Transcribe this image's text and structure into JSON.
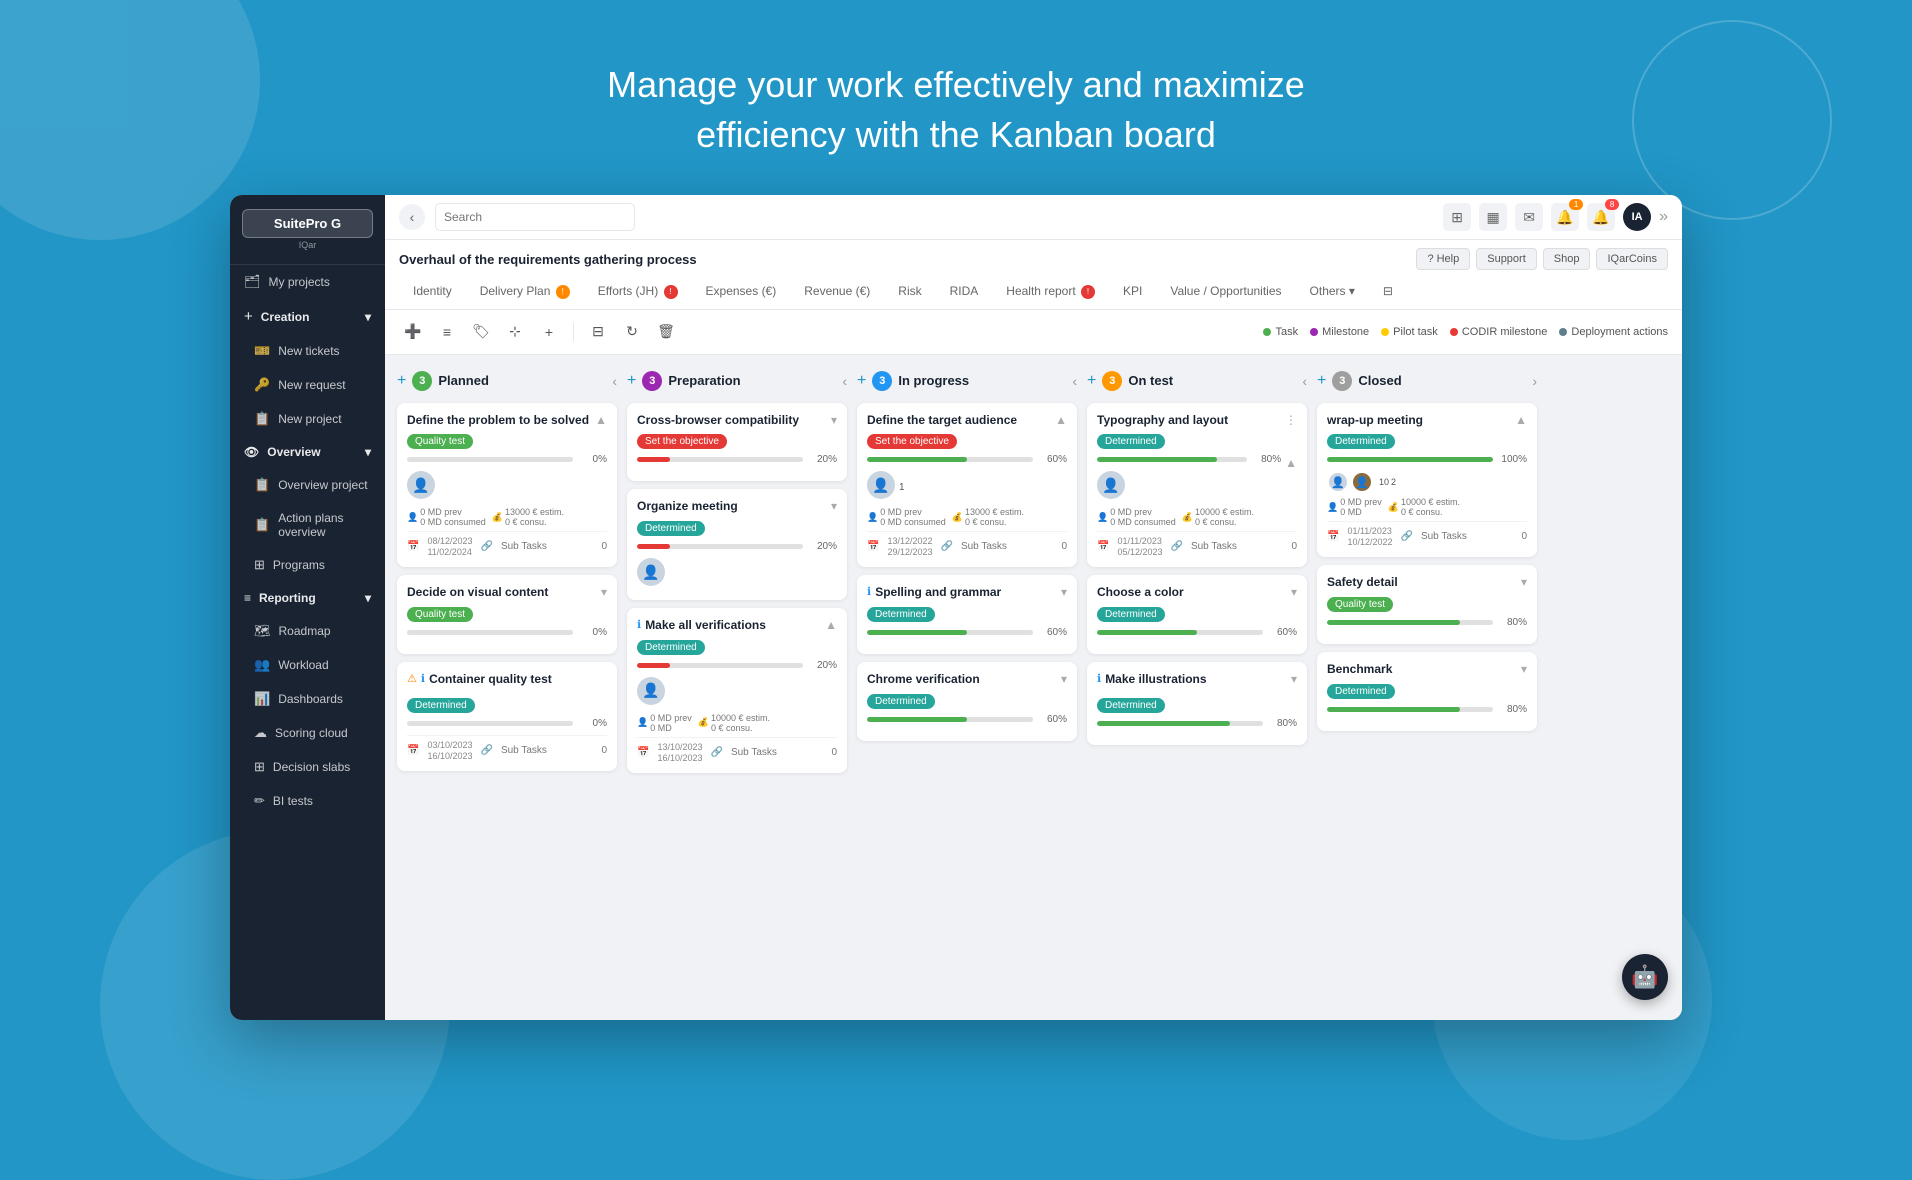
{
  "page": {
    "headline_line1": "Manage your work effectively and maximize",
    "headline_line2": "efficiency with the Kanban board"
  },
  "sidebar": {
    "logo": "SuitePro G",
    "logo_sub": "IQar",
    "items": [
      {
        "label": "My projects",
        "icon": "🗂"
      },
      {
        "label": "Creation",
        "icon": "+",
        "section": true
      },
      {
        "label": "New tickets",
        "icon": "🎫"
      },
      {
        "label": "New request",
        "icon": "🔑"
      },
      {
        "label": "New project",
        "icon": "📋"
      },
      {
        "label": "Overview",
        "icon": "👁",
        "section": true
      },
      {
        "label": "Overview project",
        "icon": "📋"
      },
      {
        "label": "Action plans overview",
        "icon": "📋"
      },
      {
        "label": "Programs",
        "icon": "⊞"
      },
      {
        "label": "Reporting",
        "icon": "≡",
        "section": true
      },
      {
        "label": "Roadmap",
        "icon": "🗺"
      },
      {
        "label": "Workload",
        "icon": "👥"
      },
      {
        "label": "Dashboards",
        "icon": "📊"
      },
      {
        "label": "Scoring cloud",
        "icon": "☁"
      },
      {
        "label": "Decision slabs",
        "icon": "⊞"
      },
      {
        "label": "BI tests",
        "icon": "✏"
      }
    ]
  },
  "topbar": {
    "search_placeholder": "Search",
    "back_label": "‹",
    "collapse_label": "»",
    "avatar_label": "IA",
    "notification_count": "1",
    "bell_count": "8"
  },
  "project": {
    "title": "Overhaul of the requirements gathering process",
    "actions": {
      "help": "? Help",
      "support": "Support",
      "shop": "Shop",
      "coins": "IQarCoins"
    }
  },
  "tabs": [
    {
      "label": "Identity",
      "active": false
    },
    {
      "label": "Delivery Plan",
      "active": false,
      "badge": "orange"
    },
    {
      "label": "Efforts (JH)",
      "active": false,
      "badge": "red"
    },
    {
      "label": "Expenses (€)",
      "active": false
    },
    {
      "label": "Revenue (€)",
      "active": false
    },
    {
      "label": "Risk",
      "active": false
    },
    {
      "label": "RIDA",
      "active": false
    },
    {
      "label": "Health report",
      "active": false,
      "badge": "red"
    },
    {
      "label": "KPI",
      "active": false
    },
    {
      "label": "Value / Opportunities",
      "active": false
    },
    {
      "label": "Others",
      "active": false
    }
  ],
  "legend": {
    "items": [
      {
        "label": "Task",
        "color": "#4caf50"
      },
      {
        "label": "Milestone",
        "color": "#9c27b0"
      },
      {
        "label": "Pilot task",
        "color": "#ffcc00"
      },
      {
        "label": "CODIR milestone",
        "color": "#e53935"
      },
      {
        "label": "Deployment actions",
        "color": "#607d8b"
      }
    ]
  },
  "columns": [
    {
      "id": "planned",
      "title": "Planned",
      "count": 3,
      "badge_class": "col-badge-planned",
      "cards": [
        {
          "title": "Define the problem to be solved",
          "tag": "Quality test",
          "tag_class": "tag-green",
          "progress": 0,
          "progress_color": "#4caf50",
          "has_avatar": true,
          "show_meta": true,
          "md_prev": "0 MD prev",
          "md_cons": "0 MD consumed",
          "budget": "13000 € estim.",
          "budget_cons": "0 € consu.",
          "date1": "08/12/2023",
          "date2": "11/02/2024",
          "subtasks": "Sub Tasks",
          "subtasks_count": "0"
        },
        {
          "title": "Decide on visual content",
          "tag": "Quality test",
          "tag_class": "tag-green",
          "progress": 0,
          "progress_color": "#4caf50",
          "show_chevron": true
        },
        {
          "title": "Container quality test",
          "tag": "Determined",
          "tag_class": "tag-determined",
          "progress": 0,
          "progress_color": "#26a69a",
          "warning": true,
          "info": true,
          "date1": "03/10/2023",
          "date2": "16/10/2023",
          "subtasks": "Sub Tasks",
          "subtasks_count": "0"
        }
      ]
    },
    {
      "id": "preparation",
      "title": "Preparation",
      "count": 3,
      "badge_class": "col-badge-prep",
      "cards": [
        {
          "title": "Cross-browser compatibility",
          "tag": "Set the objective",
          "tag_class": "tag-red",
          "progress": 20,
          "progress_color": "#e53935",
          "show_chevron": true
        },
        {
          "title": "Organize meeting",
          "tag": "Determined",
          "tag_class": "tag-determined",
          "progress": 20,
          "progress_color": "#e53935",
          "has_avatar": true,
          "show_chevron": true
        },
        {
          "title": "Make all verifications",
          "tag": "Determined",
          "tag_class": "tag-determined",
          "progress": 20,
          "progress_color": "#e53935",
          "has_avatar": true,
          "md_prev": "0 MD prev",
          "md_cons": "0 MD",
          "budget": "10000 € estim.",
          "budget_cons": "0 € consu.",
          "date1": "13/10/2023",
          "date2": "16/10/2023",
          "subtasks": "Sub Tasks",
          "subtasks_count": "0"
        }
      ]
    },
    {
      "id": "inprogress",
      "title": "In progress",
      "count": 3,
      "badge_class": "col-badge-progress",
      "cards": [
        {
          "title": "Define the target audience",
          "tag": "Set the objective",
          "tag_class": "tag-red",
          "progress": 60,
          "progress_color": "#4caf50",
          "has_avatar": true,
          "show_meta": true,
          "md_prev": "0 MD prev",
          "md_cons": "0 MD consumed",
          "budget": "13000 € estim.",
          "budget_cons": "0 € consu.",
          "date1": "13/12/2022",
          "date2": "29/12/2023",
          "subtasks": "Sub Tasks",
          "subtasks_count": "0",
          "number": "1"
        },
        {
          "title": "Spelling and grammar",
          "tag": "Determined",
          "tag_class": "tag-determined",
          "progress": 60,
          "progress_color": "#4caf50",
          "show_chevron": true
        },
        {
          "title": "Chrome verification",
          "tag": "Determined",
          "tag_class": "tag-determined",
          "progress": 60,
          "progress_color": "#4caf50",
          "show_chevron": true
        }
      ]
    },
    {
      "id": "ontest",
      "title": "On test",
      "count": 3,
      "badge_class": "col-badge-test",
      "cards": [
        {
          "title": "Typography and layout",
          "tag": "Determined",
          "tag_class": "tag-determined",
          "progress": 80,
          "progress_color": "#4caf50",
          "has_avatar": true,
          "show_meta": true,
          "md_prev": "0 MD prev",
          "md_cons": "0 MD consumed",
          "budget": "10000 € estim.",
          "budget_cons": "0 € consu.",
          "date1": "01/11/2023",
          "date2": "05/12/2023",
          "subtasks": "Sub Tasks",
          "subtasks_count": "0",
          "show_more": true
        },
        {
          "title": "Choose a color",
          "tag": "Determined",
          "tag_class": "tag-determined",
          "progress": 60,
          "progress_color": "#4caf50",
          "show_chevron": true
        },
        {
          "title": "Make illustrations",
          "tag": "Determined",
          "tag_class": "tag-determined",
          "progress": 80,
          "progress_color": "#4caf50",
          "show_chevron": true,
          "info": true
        }
      ]
    },
    {
      "id": "closed",
      "title": "Closed",
      "count": 3,
      "badge_class": "col-badge-closed",
      "cards": [
        {
          "title": "wrap-up meeting",
          "tag": "Determined",
          "tag_class": "tag-determined",
          "progress": 100,
          "progress_color": "#4caf50",
          "has_avatars": true,
          "show_meta": true,
          "avatars_count": [
            "10",
            "2"
          ],
          "md_prev": "0 MD prev",
          "md_cons": "0 MD",
          "budget": "10000 € estim.",
          "budget_cons": "0 € consu.",
          "date1": "01/11/2023",
          "date2": "10/12/2022",
          "subtasks": "Sub Tasks",
          "subtasks_count": "0"
        },
        {
          "title": "Safety detail",
          "tag": "Quality test",
          "tag_class": "tag-green",
          "progress": 80,
          "progress_color": "#4caf50",
          "show_chevron": true
        },
        {
          "title": "Benchmark",
          "tag": "Determined",
          "tag_class": "tag-determined",
          "progress": 80,
          "progress_color": "#4caf50",
          "show_chevron": true
        }
      ]
    }
  ],
  "chatbot": {
    "icon": "👁"
  }
}
